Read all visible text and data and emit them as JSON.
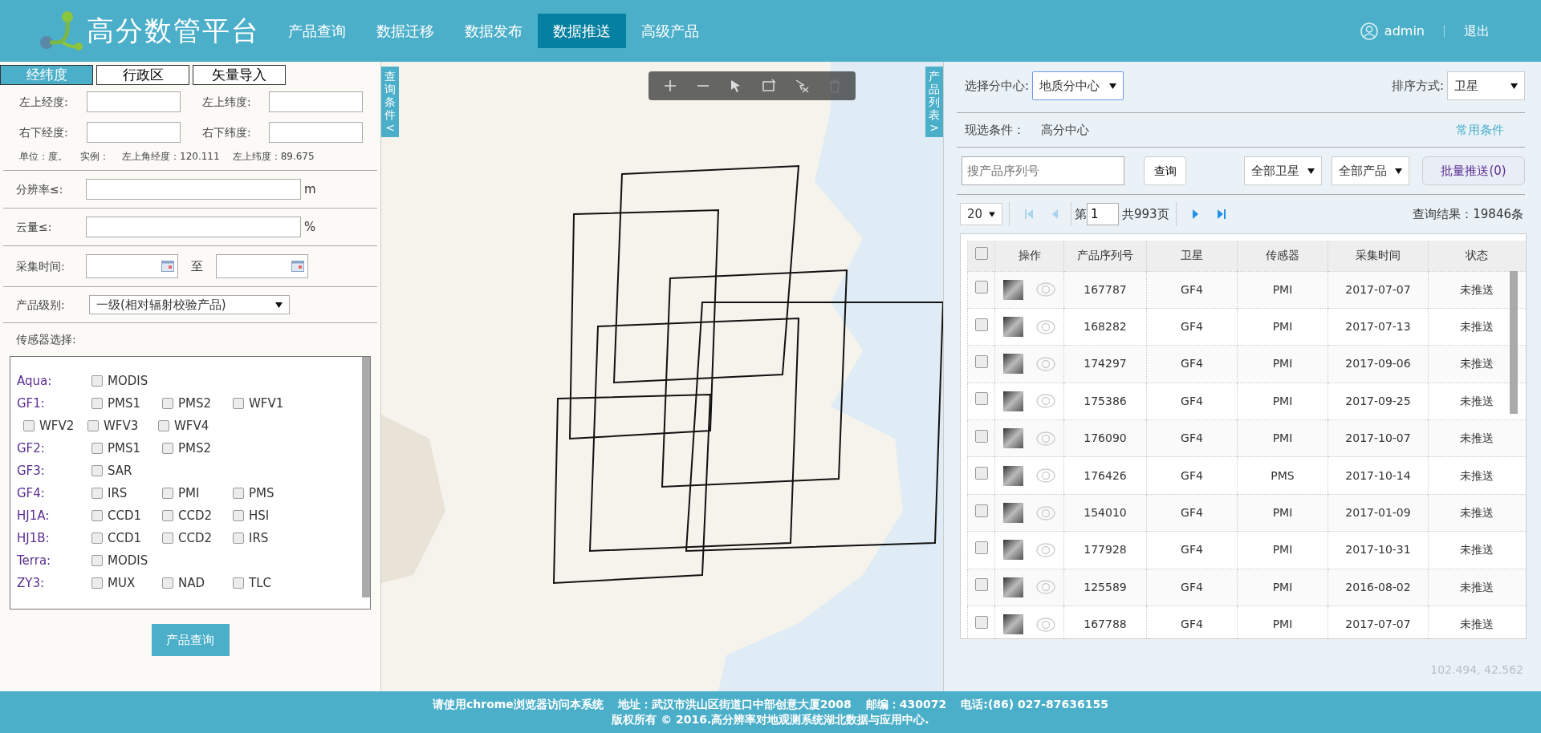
{
  "header": {
    "logo_text": "高分数管平台",
    "nav": [
      {
        "label": "产品查询",
        "selected": false
      },
      {
        "label": "数据迁移",
        "selected": false
      },
      {
        "label": "数据发布",
        "selected": false
      },
      {
        "label": "数据推送",
        "selected": true
      },
      {
        "label": "高级产品",
        "selected": false
      }
    ],
    "user": "admin",
    "logout": "退出"
  },
  "query_panel": {
    "tabs": [
      {
        "label": "经纬度",
        "selected": true
      },
      {
        "label": "行政区",
        "selected": false
      },
      {
        "label": "矢量导入",
        "selected": false
      }
    ],
    "coords": [
      {
        "label": "左上经度:"
      },
      {
        "label": "左上纬度:"
      },
      {
        "label": "右下经度:"
      },
      {
        "label": "右下纬度:"
      }
    ],
    "coord_hint": [
      "单位：度。",
      "实例：",
      "左上角经度：120.111",
      "左上纬度：89.675"
    ],
    "resolution": {
      "label": "分辨率≤:",
      "unit": "m"
    },
    "cloud": {
      "label": "云量≤:",
      "unit": "%"
    },
    "time": {
      "label": "采集时间:",
      "separator": "至"
    },
    "level": {
      "label": "产品级别:",
      "value": "一级(相对辐射校验产品)"
    },
    "sensor_label": "传感器选择:",
    "sensors": [
      {
        "satellite": "Aqua:",
        "items": [
          {
            "label": "MODIS",
            "checked": false
          }
        ]
      },
      {
        "satellite": "GF1:",
        "items": [
          {
            "label": "PMS1",
            "checked": false
          },
          {
            "label": "PMS2",
            "checked": false
          },
          {
            "label": "WFV1",
            "checked": false
          },
          {
            "label": "WFV2",
            "checked": false
          },
          {
            "label": "WFV3",
            "checked": false
          },
          {
            "label": "WFV4",
            "checked": false
          }
        ]
      },
      {
        "satellite": "GF2:",
        "items": [
          {
            "label": "PMS1",
            "checked": false
          },
          {
            "label": "PMS2",
            "checked": false
          }
        ]
      },
      {
        "satellite": "GF3:",
        "items": [
          {
            "label": "SAR",
            "checked": false
          }
        ]
      },
      {
        "satellite": "GF4:",
        "items": [
          {
            "label": "IRS",
            "checked": false
          },
          {
            "label": "PMI",
            "checked": false
          },
          {
            "label": "PMS",
            "checked": false
          }
        ]
      },
      {
        "satellite": "HJ1A:",
        "items": [
          {
            "label": "CCD1",
            "checked": false
          },
          {
            "label": "CCD2",
            "checked": false
          },
          {
            "label": "HSI",
            "checked": false
          }
        ]
      },
      {
        "satellite": "HJ1B:",
        "items": [
          {
            "label": "CCD1",
            "checked": false
          },
          {
            "label": "CCD2",
            "checked": false
          },
          {
            "label": "IRS",
            "checked": false
          }
        ]
      },
      {
        "satellite": "Terra:",
        "items": [
          {
            "label": "MODIS",
            "checked": false
          }
        ]
      },
      {
        "satellite": "ZY3:",
        "items": [
          {
            "label": "MUX",
            "checked": false
          },
          {
            "label": "NAD",
            "checked": false
          },
          {
            "label": "TLC",
            "checked": false
          }
        ]
      }
    ],
    "submit": "产品查询"
  },
  "map": {
    "left_toggle": {
      "label": "查询条件",
      "arrow": "<"
    },
    "right_toggle": {
      "label": "产品列表",
      "arrow": ">"
    },
    "tools": [
      {
        "kind": "plus",
        "disabled": false
      },
      {
        "kind": "minus",
        "disabled": false
      },
      {
        "kind": "pointer",
        "disabled": false
      },
      {
        "kind": "rect",
        "disabled": false
      },
      {
        "kind": "clear",
        "disabled": false
      },
      {
        "kind": "trash",
        "disabled": true
      }
    ]
  },
  "results_panel": {
    "center": {
      "label": "选择分中心:",
      "value": "地质分中心"
    },
    "sort": {
      "label": "排序方式:",
      "value": "卫星"
    },
    "current": {
      "label": "现选条件：",
      "value": "高分中心",
      "link": "常用条件"
    },
    "search": {
      "placeholder": "搜产品序列号",
      "button": "查询"
    },
    "satellite_filter": "全部卫星",
    "product_filter": "全部产品",
    "batch_push": "批量推送(0)",
    "pagination": {
      "page_size": "20",
      "first_disabled": true,
      "prev_disabled": true,
      "page_prefix": "第",
      "page": "1",
      "total": "共993页",
      "next_disabled": false,
      "last_disabled": false,
      "result": "查询结果：19846条"
    },
    "table": {
      "header_checked": false,
      "columns": [
        "操作",
        "产品序列号",
        "卫星",
        "传感器",
        "采集时间",
        "状态"
      ],
      "rows": [
        {
          "checked": false,
          "id": "167787",
          "satellite": "GF4",
          "sensor": "PMI",
          "date": "2017-07-07",
          "status": "未推送"
        },
        {
          "checked": false,
          "id": "168282",
          "satellite": "GF4",
          "sensor": "PMI",
          "date": "2017-07-13",
          "status": "未推送"
        },
        {
          "checked": false,
          "id": "174297",
          "satellite": "GF4",
          "sensor": "PMI",
          "date": "2017-09-06",
          "status": "未推送"
        },
        {
          "checked": false,
          "id": "175386",
          "satellite": "GF4",
          "sensor": "PMI",
          "date": "2017-09-25",
          "status": "未推送"
        },
        {
          "checked": false,
          "id": "176090",
          "satellite": "GF4",
          "sensor": "PMI",
          "date": "2017-10-07",
          "status": "未推送"
        },
        {
          "checked": false,
          "id": "176426",
          "satellite": "GF4",
          "sensor": "PMS",
          "date": "2017-10-14",
          "status": "未推送"
        },
        {
          "checked": false,
          "id": "154010",
          "satellite": "GF4",
          "sensor": "PMI",
          "date": "2017-01-09",
          "status": "未推送"
        },
        {
          "checked": false,
          "id": "177928",
          "satellite": "GF4",
          "sensor": "PMI",
          "date": "2017-10-31",
          "status": "未推送"
        },
        {
          "checked": false,
          "id": "125589",
          "satellite": "GF4",
          "sensor": "PMI",
          "date": "2016-08-02",
          "status": "未推送"
        },
        {
          "checked": false,
          "id": "167788",
          "satellite": "GF4",
          "sensor": "PMI",
          "date": "2017-07-07",
          "status": "未推送"
        }
      ]
    },
    "coordinates": "102.494, 42.562"
  },
  "footer": {
    "line1": [
      "请使用chrome浏览器访问本系统",
      "地址：武汉市洪山区街道口中部创意大厦2008",
      "邮编：430072",
      "电话:(86) 027-87636155"
    ],
    "line2": "版权所有 © 2016.高分辨率对地观测系统湖北数据与应用中心."
  }
}
